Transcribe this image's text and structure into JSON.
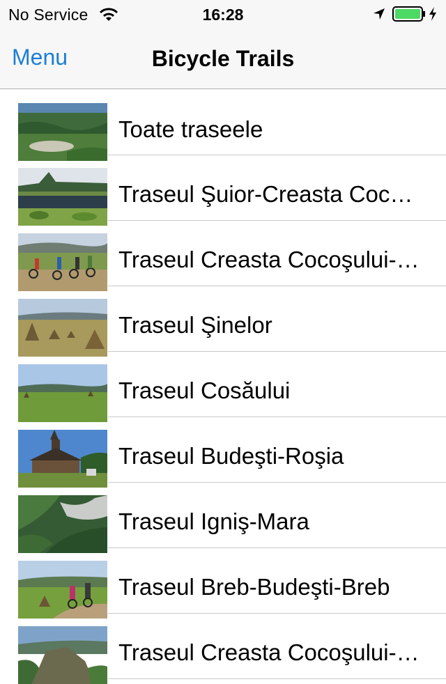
{
  "status": {
    "carrier": "No Service",
    "time": "16:28",
    "battery_color": "#4cd964"
  },
  "nav": {
    "back_label": "Menu",
    "title": "Bicycle Trails",
    "accent_color": "#1b7fd6"
  },
  "trails": [
    {
      "label": "Toate traseele",
      "thumb": "forest-valley-photo"
    },
    {
      "label": "Traseul Şuior-Creasta Coc…",
      "thumb": "mountain-lake-photo"
    },
    {
      "label": "Traseul Creasta Cocoşului-…",
      "thumb": "cyclists-photo"
    },
    {
      "label": "Traseul Şinelor",
      "thumb": "haystacks-photo"
    },
    {
      "label": "Traseul Cosăului",
      "thumb": "meadow-photo"
    },
    {
      "label": "Traseul Budeşti-Roşia",
      "thumb": "wooden-church-photo"
    },
    {
      "label": "Traseul Igniş-Mara",
      "thumb": "forest-aerial-photo"
    },
    {
      "label": "Traseul Breb-Budeşti-Breb",
      "thumb": "cyclists-haystacks-photo"
    },
    {
      "label": "Traseul Creasta Cocoşului-…",
      "thumb": "rocky-crest-photo"
    }
  ]
}
